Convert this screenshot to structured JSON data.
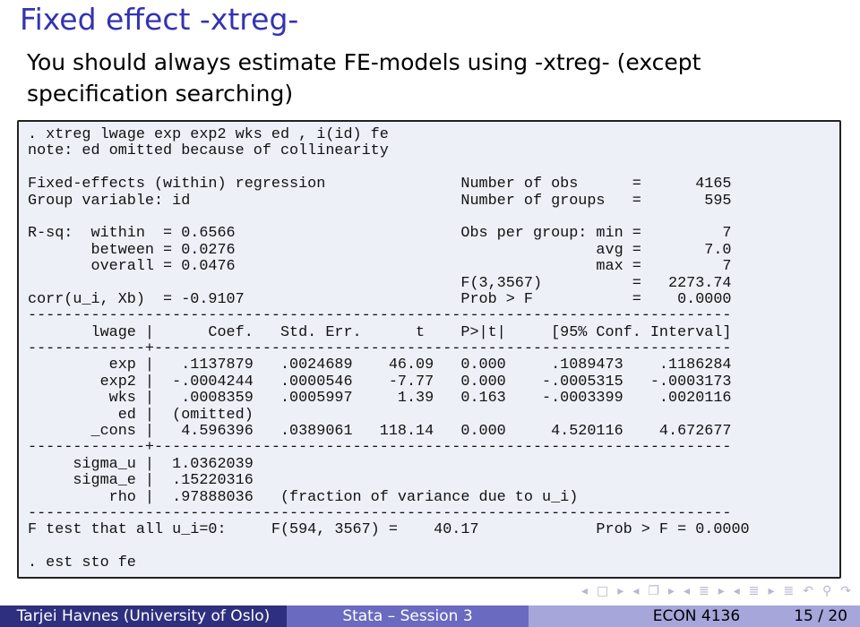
{
  "slide": {
    "title": "Fixed effect -xtreg-",
    "subtitle": "You should always estimate FE-models using -xtreg- (except specification searching)"
  },
  "stata_output": [
    ". xtreg lwage exp exp2 wks ed , i(id) fe",
    "note: ed omitted because of collinearity",
    "",
    "Fixed-effects (within) regression               Number of obs      =      4165",
    "Group variable: id                              Number of groups   =       595",
    "",
    "R-sq:  within  = 0.6566                         Obs per group: min =         7",
    "       between = 0.0276                                        avg =       7.0",
    "       overall = 0.0476                                        max =         7",
    "                                                F(3,3567)          =   2273.74",
    "corr(u_i, Xb)  = -0.9107                        Prob > F           =    0.0000",
    "------------------------------------------------------------------------------",
    "       lwage |      Coef.   Std. Err.      t    P>|t|     [95% Conf. Interval]",
    "-------------+----------------------------------------------------------------",
    "         exp |   .1137879   .0024689    46.09   0.000     .1089473    .1186284",
    "        exp2 |  -.0004244   .0000546    -7.77   0.000    -.0005315   -.0003173",
    "         wks |   .0008359   .0005997     1.39   0.163    -.0003399    .0020116",
    "          ed |  (omitted)",
    "       _cons |   4.596396   .0389061   118.14   0.000     4.520116    4.672677",
    "-------------+----------------------------------------------------------------",
    "     sigma_u |  1.0362039",
    "     sigma_e |  .15220316",
    "         rho |  .97888036   (fraction of variance due to u_i)",
    "------------------------------------------------------------------------------",
    "F test that all u_i=0:     F(594, 3567) =    40.17             Prob > F = 0.0000",
    "",
    ". est sto fe"
  ],
  "footer": {
    "author": "Tarjei Havnes  (University of Oslo)",
    "session": "Stata – Session 3",
    "course": "ECON 4136",
    "page": "15 / 20"
  },
  "nav_icons": [
    "frame-prev-icon",
    "frame-icon",
    "frame-next-icon",
    "subsection-prev-icon",
    "subsection-icon",
    "subsection-next-icon",
    "section-prev-icon",
    "section-icon",
    "section-next-icon",
    "toc-icon",
    "back-icon",
    "search-icon",
    "forward-icon"
  ]
}
